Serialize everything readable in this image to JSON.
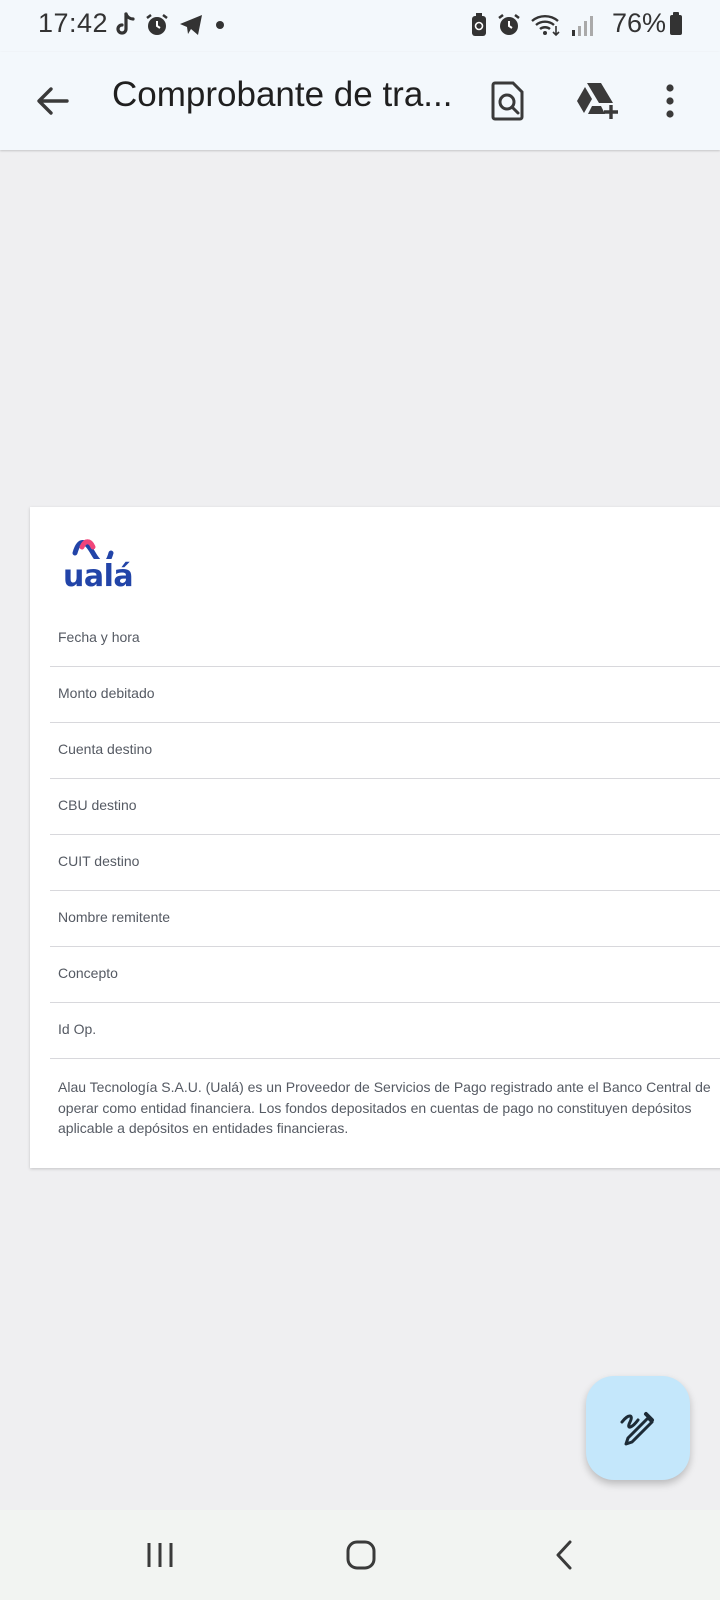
{
  "status_bar": {
    "time": "17:42",
    "battery_percent": "76%",
    "left_icons": [
      "tiktok-icon",
      "alarm-icon",
      "telegram-icon",
      "dot-icon"
    ],
    "right_icons": [
      "battery-saver-icon",
      "alarm-icon",
      "wifi-icon",
      "signal-icon"
    ]
  },
  "app_bar": {
    "title": "Comprobante de tra...",
    "back_icon": "arrow-back-icon",
    "actions": [
      "search-document-icon",
      "drive-add-icon",
      "more-vert-icon"
    ]
  },
  "document": {
    "logo_text": "ualá",
    "rows": [
      {
        "label": "Fecha y hora"
      },
      {
        "label": "Monto debitado"
      },
      {
        "label": "Cuenta destino"
      },
      {
        "label": "CBU destino"
      },
      {
        "label": "CUIT destino"
      },
      {
        "label": "Nombre remitente"
      },
      {
        "label": "Concepto"
      },
      {
        "label": "Id Op."
      }
    ],
    "disclaimer_lines": [
      "Alau Tecnología S.A.U. (Ualá) es un Proveedor de Servicios de Pago registrado ante el Banco Central de",
      "operar como entidad financiera. Los fondos depositados en cuentas de pago no constituyen depósitos",
      "aplicable a depósitos en entidades financieras."
    ]
  },
  "fab": {
    "icon": "edit-pen-icon"
  },
  "nav_bar": {
    "buttons": [
      "recents-icon",
      "home-icon",
      "back-icon"
    ]
  },
  "colors": {
    "app_bar_bg": "#f3f8fc",
    "page_bg": "#efeff1",
    "fab_bg": "#c4e7fb",
    "logo_blue": "#2244a8",
    "logo_pink": "#f0457a"
  }
}
